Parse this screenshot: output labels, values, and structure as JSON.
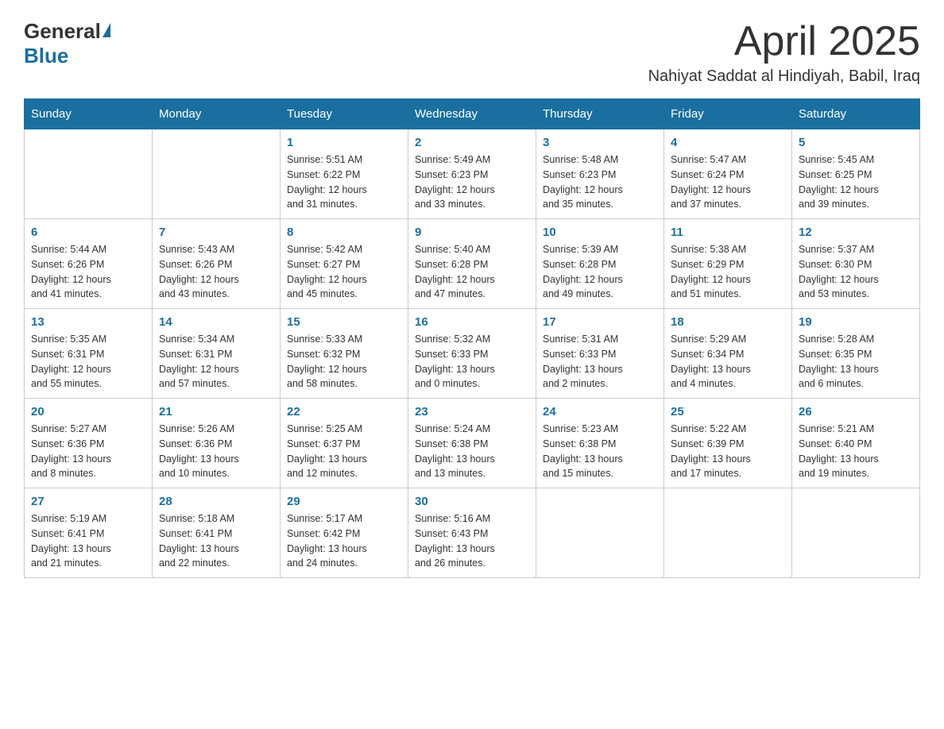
{
  "header": {
    "logo_general": "General",
    "logo_blue": "Blue",
    "month_title": "April 2025",
    "location": "Nahiyat Saddat al Hindiyah, Babil, Iraq"
  },
  "weekdays": [
    "Sunday",
    "Monday",
    "Tuesday",
    "Wednesday",
    "Thursday",
    "Friday",
    "Saturday"
  ],
  "weeks": [
    [
      {
        "day": "",
        "info": ""
      },
      {
        "day": "",
        "info": ""
      },
      {
        "day": "1",
        "info": "Sunrise: 5:51 AM\nSunset: 6:22 PM\nDaylight: 12 hours\nand 31 minutes."
      },
      {
        "day": "2",
        "info": "Sunrise: 5:49 AM\nSunset: 6:23 PM\nDaylight: 12 hours\nand 33 minutes."
      },
      {
        "day": "3",
        "info": "Sunrise: 5:48 AM\nSunset: 6:23 PM\nDaylight: 12 hours\nand 35 minutes."
      },
      {
        "day": "4",
        "info": "Sunrise: 5:47 AM\nSunset: 6:24 PM\nDaylight: 12 hours\nand 37 minutes."
      },
      {
        "day": "5",
        "info": "Sunrise: 5:45 AM\nSunset: 6:25 PM\nDaylight: 12 hours\nand 39 minutes."
      }
    ],
    [
      {
        "day": "6",
        "info": "Sunrise: 5:44 AM\nSunset: 6:26 PM\nDaylight: 12 hours\nand 41 minutes."
      },
      {
        "day": "7",
        "info": "Sunrise: 5:43 AM\nSunset: 6:26 PM\nDaylight: 12 hours\nand 43 minutes."
      },
      {
        "day": "8",
        "info": "Sunrise: 5:42 AM\nSunset: 6:27 PM\nDaylight: 12 hours\nand 45 minutes."
      },
      {
        "day": "9",
        "info": "Sunrise: 5:40 AM\nSunset: 6:28 PM\nDaylight: 12 hours\nand 47 minutes."
      },
      {
        "day": "10",
        "info": "Sunrise: 5:39 AM\nSunset: 6:28 PM\nDaylight: 12 hours\nand 49 minutes."
      },
      {
        "day": "11",
        "info": "Sunrise: 5:38 AM\nSunset: 6:29 PM\nDaylight: 12 hours\nand 51 minutes."
      },
      {
        "day": "12",
        "info": "Sunrise: 5:37 AM\nSunset: 6:30 PM\nDaylight: 12 hours\nand 53 minutes."
      }
    ],
    [
      {
        "day": "13",
        "info": "Sunrise: 5:35 AM\nSunset: 6:31 PM\nDaylight: 12 hours\nand 55 minutes."
      },
      {
        "day": "14",
        "info": "Sunrise: 5:34 AM\nSunset: 6:31 PM\nDaylight: 12 hours\nand 57 minutes."
      },
      {
        "day": "15",
        "info": "Sunrise: 5:33 AM\nSunset: 6:32 PM\nDaylight: 12 hours\nand 58 minutes."
      },
      {
        "day": "16",
        "info": "Sunrise: 5:32 AM\nSunset: 6:33 PM\nDaylight: 13 hours\nand 0 minutes."
      },
      {
        "day": "17",
        "info": "Sunrise: 5:31 AM\nSunset: 6:33 PM\nDaylight: 13 hours\nand 2 minutes."
      },
      {
        "day": "18",
        "info": "Sunrise: 5:29 AM\nSunset: 6:34 PM\nDaylight: 13 hours\nand 4 minutes."
      },
      {
        "day": "19",
        "info": "Sunrise: 5:28 AM\nSunset: 6:35 PM\nDaylight: 13 hours\nand 6 minutes."
      }
    ],
    [
      {
        "day": "20",
        "info": "Sunrise: 5:27 AM\nSunset: 6:36 PM\nDaylight: 13 hours\nand 8 minutes."
      },
      {
        "day": "21",
        "info": "Sunrise: 5:26 AM\nSunset: 6:36 PM\nDaylight: 13 hours\nand 10 minutes."
      },
      {
        "day": "22",
        "info": "Sunrise: 5:25 AM\nSunset: 6:37 PM\nDaylight: 13 hours\nand 12 minutes."
      },
      {
        "day": "23",
        "info": "Sunrise: 5:24 AM\nSunset: 6:38 PM\nDaylight: 13 hours\nand 13 minutes."
      },
      {
        "day": "24",
        "info": "Sunrise: 5:23 AM\nSunset: 6:38 PM\nDaylight: 13 hours\nand 15 minutes."
      },
      {
        "day": "25",
        "info": "Sunrise: 5:22 AM\nSunset: 6:39 PM\nDaylight: 13 hours\nand 17 minutes."
      },
      {
        "day": "26",
        "info": "Sunrise: 5:21 AM\nSunset: 6:40 PM\nDaylight: 13 hours\nand 19 minutes."
      }
    ],
    [
      {
        "day": "27",
        "info": "Sunrise: 5:19 AM\nSunset: 6:41 PM\nDaylight: 13 hours\nand 21 minutes."
      },
      {
        "day": "28",
        "info": "Sunrise: 5:18 AM\nSunset: 6:41 PM\nDaylight: 13 hours\nand 22 minutes."
      },
      {
        "day": "29",
        "info": "Sunrise: 5:17 AM\nSunset: 6:42 PM\nDaylight: 13 hours\nand 24 minutes."
      },
      {
        "day": "30",
        "info": "Sunrise: 5:16 AM\nSunset: 6:43 PM\nDaylight: 13 hours\nand 26 minutes."
      },
      {
        "day": "",
        "info": ""
      },
      {
        "day": "",
        "info": ""
      },
      {
        "day": "",
        "info": ""
      }
    ]
  ]
}
